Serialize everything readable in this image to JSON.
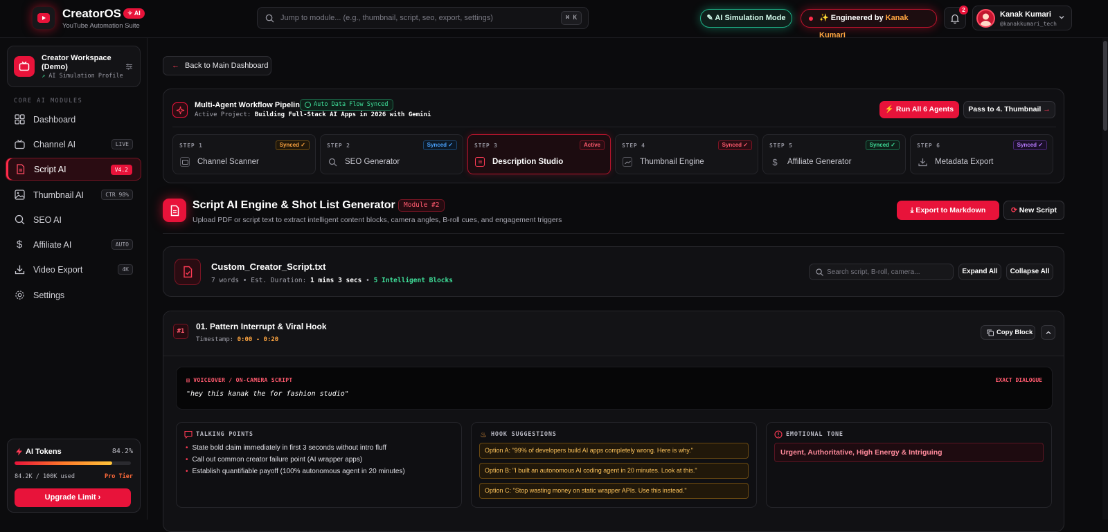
{
  "brand": {
    "title": "CreatorOS",
    "ai_badge": "AI",
    "subtitle": "YouTube Automation Suite"
  },
  "search": {
    "placeholder": "Jump to module... (e.g., thumbnail, script, seo, export, settings)",
    "shortcut": "⌘ K"
  },
  "header": {
    "sim_mode": "AI Simulation Mode",
    "engineered_prefix": "Engineered by",
    "engineered_name": "Kanak Kumari",
    "notifications": "2",
    "user_name": "Kanak Kumari",
    "user_handle": "@kanakkumari_tech"
  },
  "workspace": {
    "name": "Creator Workspace (Demo)",
    "profile": "AI Simulation Profile"
  },
  "sidebar": {
    "section_label": "CORE AI MODULES",
    "items": [
      {
        "label": "Dashboard",
        "tag": ""
      },
      {
        "label": "Channel AI",
        "tag": "LIVE"
      },
      {
        "label": "Script AI",
        "tag": "V4.2"
      },
      {
        "label": "Thumbnail AI",
        "tag": "CTR 98%"
      },
      {
        "label": "SEO AI",
        "tag": ""
      },
      {
        "label": "Affiliate AI",
        "tag": "AUTO"
      },
      {
        "label": "Video Export",
        "tag": "4K"
      },
      {
        "label": "Settings",
        "tag": ""
      }
    ],
    "active_index": 2
  },
  "tokens": {
    "label": "AI Tokens",
    "percent_text": "84.2%",
    "fill": 0.842,
    "used": "84.2K / 100K used",
    "tier": "Pro Tier",
    "upgrade": "Upgrade Limit"
  },
  "nav": {
    "back": "Back to Main Dashboard"
  },
  "pipeline": {
    "title": "Multi-Agent Workflow Pipeline",
    "sync_badge": "Auto Data Flow Synced",
    "project_label": "Active Project:",
    "project_name": "Building Full-Stack AI Apps in 2026 with Gemini",
    "run_all": "Run All 6 Agents",
    "pass_next": "Pass to 4. Thumbnail",
    "steps": [
      {
        "step": "STEP 1",
        "status": "Synced ✓",
        "label": "Channel Scanner",
        "color": "#ffa540"
      },
      {
        "step": "STEP 2",
        "status": "Synced ✓",
        "label": "SEO Generator",
        "color": "#4aa3ff"
      },
      {
        "step": "STEP 3",
        "status": "Active",
        "label": "Description Studio",
        "color": "#ff3b55"
      },
      {
        "step": "STEP 4",
        "status": "Synced ✓",
        "label": "Thumbnail Engine",
        "color": "#ff3b55"
      },
      {
        "step": "STEP 5",
        "status": "Synced ✓",
        "label": "Affiliate Generator",
        "color": "#3fe09a"
      },
      {
        "step": "STEP 6",
        "status": "Synced ✓",
        "label": "Metadata Export",
        "color": "#b77aff"
      }
    ]
  },
  "module": {
    "title": "Script AI Engine & Shot List Generator",
    "badge": "Module #2",
    "subtitle": "Upload PDF or script text to extract intelligent content blocks, camera angles, B-roll cues, and engagement triggers",
    "export": "Export to Markdown",
    "new_script": "New Script"
  },
  "file": {
    "name": "Custom_Creator_Script.txt",
    "words": "7 words",
    "duration_label": "Est. Duration:",
    "duration": "1 mins 3 secs",
    "blocks": "5 Intelligent Blocks",
    "search_placeholder": "Search script, B-roll, camera...",
    "expand": "Expand All",
    "collapse": "Collapse All"
  },
  "block": {
    "num": "#1",
    "title": "01. Pattern Interrupt & Viral Hook",
    "timestamp_label": "Timestamp:",
    "timestamp": "0:00 - 0:20",
    "copy": "Copy Block",
    "vo_label": "VOICEOVER / ON-CAMERA SCRIPT",
    "vo_exact": "EXACT DIALOGUE",
    "vo_text": "\"hey this kanak the for fashion studio\"",
    "talking_label": "TALKING POINTS",
    "talking_points": [
      "State bold claim immediately in first 3 seconds without intro fluff",
      "Call out common creator failure point (AI wrapper apps)",
      "Establish quantifiable payoff (100% autonomous agent in 20 minutes)"
    ],
    "hooks_label": "HOOK SUGGESTIONS",
    "hooks": [
      "Option A: \"99% of developers build AI apps completely wrong. Here is why.\"",
      "Option B: \"I built an autonomous AI coding agent in 20 minutes. Look at this.\"",
      "Option C: \"Stop wasting money on static wrapper APIs. Use this instead.\""
    ],
    "tone_label": "EMOTIONAL TONE",
    "tone": "Urgent, Authoritative, High Energy & Intriguing"
  }
}
